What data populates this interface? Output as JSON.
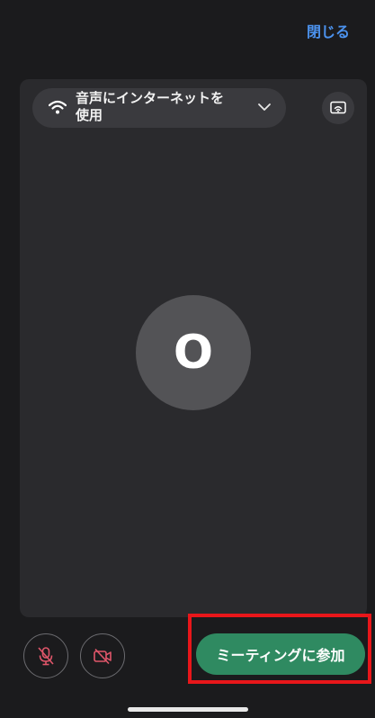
{
  "header": {
    "close_label": "閉じる"
  },
  "preview": {
    "audio_option_label": "音声にインターネットを\n使用",
    "avatar_initial": "O"
  },
  "controls": {
    "join_label": "ミーティングに参加",
    "mic_state": "muted",
    "camera_state": "off"
  },
  "colors": {
    "accent": "#4c93ef",
    "join_button": "#2f8a61",
    "muted_icon": "#e0566a",
    "highlight": "#e8161a"
  }
}
